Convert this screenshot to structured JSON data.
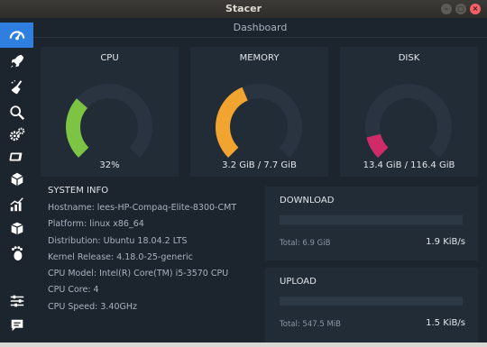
{
  "window": {
    "title": "Stacer"
  },
  "sidebar": {
    "items": [
      {
        "name": "dashboard",
        "icon": "speedometer-icon",
        "active": true
      },
      {
        "name": "startup-apps",
        "icon": "rocket-icon"
      },
      {
        "name": "system-cleaner",
        "icon": "broom-icon"
      },
      {
        "name": "search",
        "icon": "search-icon"
      },
      {
        "name": "services",
        "icon": "gears-icon"
      },
      {
        "name": "processes",
        "icon": "cpu-chip-icon"
      },
      {
        "name": "uninstaller",
        "icon": "package-icon"
      },
      {
        "name": "resources",
        "icon": "bar-chart-icon"
      },
      {
        "name": "apt-repository",
        "icon": "box-icon"
      },
      {
        "name": "gnome-settings",
        "icon": "gnome-foot-icon"
      },
      {
        "name": "settings",
        "icon": "sliders-icon"
      },
      {
        "name": "feedback",
        "icon": "speech-bubble-icon"
      }
    ]
  },
  "dashboard": {
    "title": "Dashboard",
    "cpu": {
      "label": "CPU",
      "value": "32%",
      "percent": 32,
      "color": "#7dc444"
    },
    "memory": {
      "label": "MEMORY",
      "value": "3.2 GiB / 7.7 GiB",
      "percent": 41.6,
      "color": "#f2a431"
    },
    "disk": {
      "label": "DISK",
      "value": "13.4 GiB / 116.4 GiB",
      "percent": 11.5,
      "color": "#cf2b68"
    }
  },
  "system_info": {
    "title": "SYSTEM INFO",
    "rows": [
      "Hostname: lees-HP-Compaq-Elite-8300-CMT",
      "Platform: linux x86_64",
      "Distribution: Ubuntu 18.04.2 LTS",
      "Kernel Release: 4.18.0-25-generic",
      "CPU Model: Intel(R) Core(TM) i5-3570 CPU",
      "CPU Core: 4",
      "CPU Speed: 3.40GHz"
    ]
  },
  "download": {
    "title": "DOWNLOAD",
    "total": "Total: 6.9 GiB",
    "speed": "1.9 KiB/s"
  },
  "upload": {
    "title": "UPLOAD",
    "total": "Total: 547.5 MiB",
    "speed": "1.5 KiB/s"
  },
  "gauge_track_color": "#2a3440",
  "accent_color": "#2f7fe0"
}
